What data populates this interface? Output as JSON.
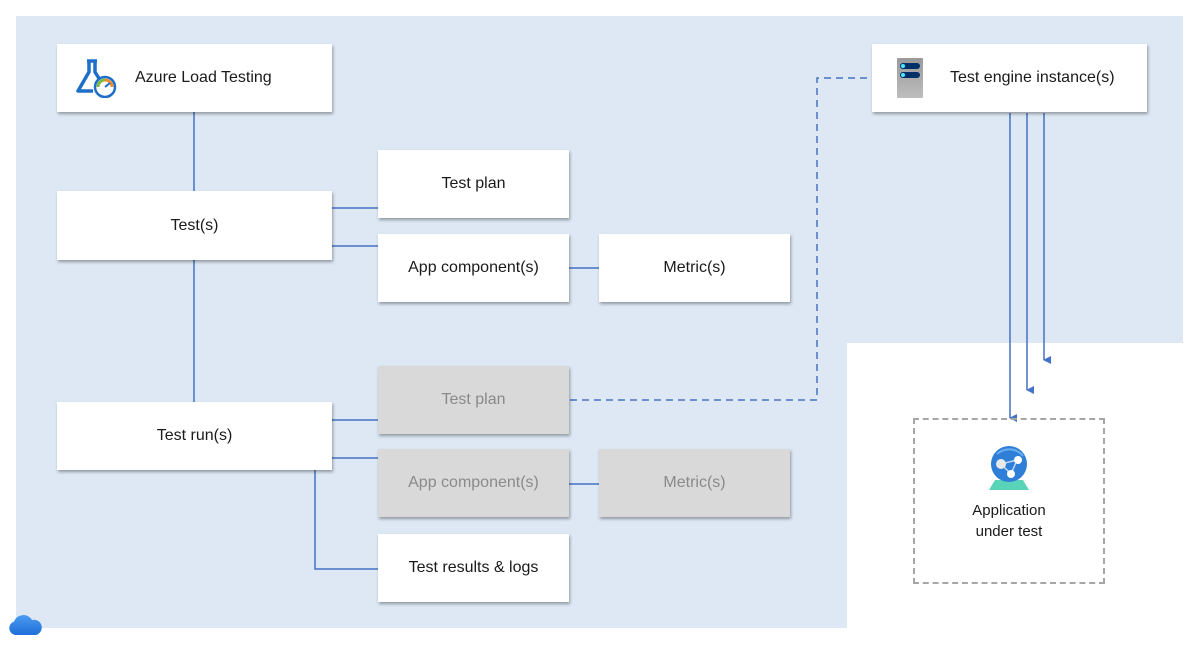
{
  "diagram": {
    "title_node": {
      "label": "Azure Load Testing",
      "icon": "azure-load-testing-icon"
    },
    "engine_node": {
      "label": "Test engine instance(s)",
      "icon": "server-icon"
    },
    "tests": {
      "label": "Test(s)",
      "children": [
        {
          "label": "Test plan",
          "state": "active"
        },
        {
          "label": "App component(s)",
          "state": "active"
        },
        {
          "label": "Metric(s)",
          "state": "active"
        }
      ]
    },
    "test_runs": {
      "label": "Test run(s)",
      "children": [
        {
          "label": "Test plan",
          "state": "inherited"
        },
        {
          "label": "App component(s)",
          "state": "inherited"
        },
        {
          "label": "Metric(s)",
          "state": "inherited"
        },
        {
          "label": "Test results & logs",
          "state": "active"
        }
      ]
    },
    "app_under_test": {
      "line1": "Application",
      "line2": "under test",
      "icon": "app-service-globe-icon"
    },
    "cloud_icon": "cloud-icon"
  },
  "colors": {
    "region_bg": "#dde8f4",
    "connector": "#4472c4",
    "inherited_box": "#d9d9d9",
    "inherited_text": "#8a8a8a",
    "dashed_border": "#a6a6a6"
  }
}
